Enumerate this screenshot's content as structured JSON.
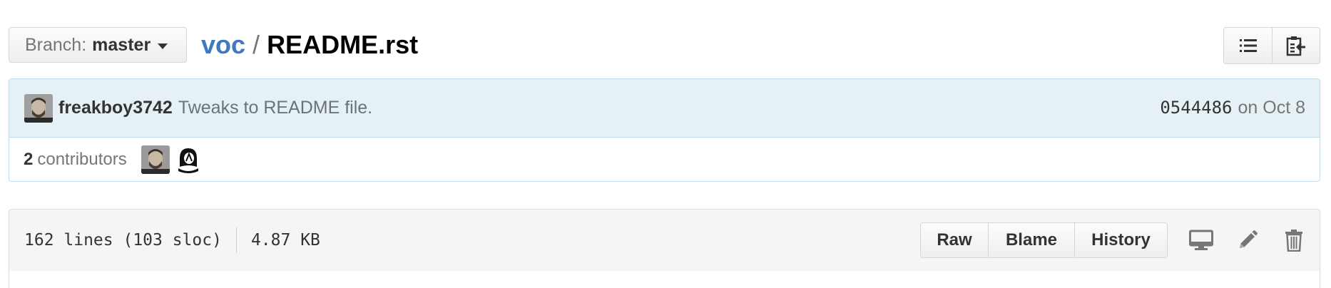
{
  "branch": {
    "prefix": "Branch:",
    "name": "master"
  },
  "breadcrumb": {
    "repo": "voc",
    "separator": "/",
    "file": "README.rst"
  },
  "top_actions": {
    "icons": [
      "list-icon",
      "clipboard-icon"
    ]
  },
  "commit": {
    "author": "freakboy3742",
    "message": "Tweaks to README file.",
    "sha": "0544486",
    "date": "on Oct 8"
  },
  "contributors": {
    "count": "2",
    "label": "contributors"
  },
  "file": {
    "lines": "162 lines (103 sloc)",
    "size": "4.87 KB",
    "buttons": {
      "raw": "Raw",
      "blame": "Blame",
      "history": "History"
    },
    "icons": [
      "desktop-icon",
      "pencil-icon",
      "trash-icon"
    ]
  },
  "colors": {
    "link": "#4078c0",
    "commit_bg": "#e6f1f6",
    "commit_border": "#c5dbe8",
    "header_bg": "#f5f5f5"
  }
}
